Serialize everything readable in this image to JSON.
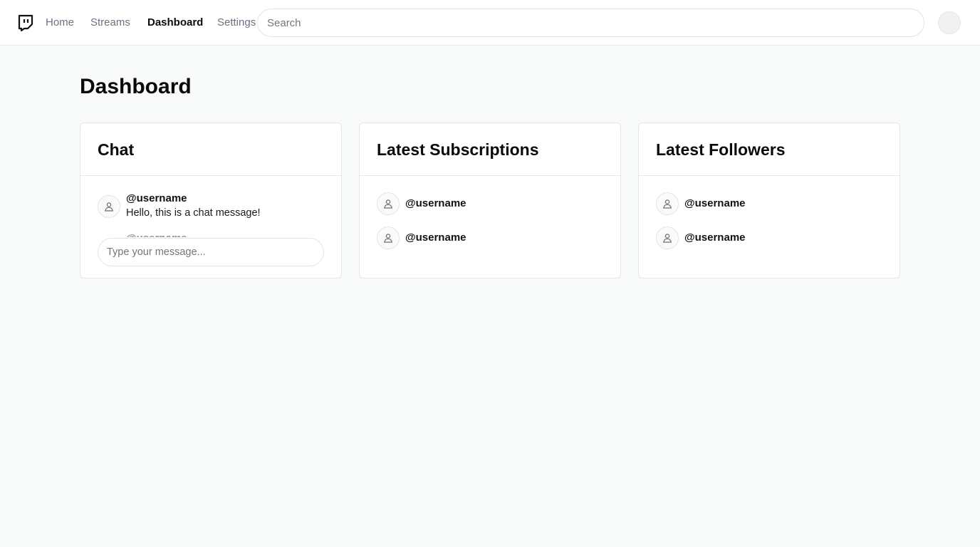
{
  "nav": {
    "logo_icon": "twitch-logo-icon",
    "links": [
      {
        "label": "Home",
        "active": false
      },
      {
        "label": "Streams",
        "active": false
      },
      {
        "label": "Dashboard",
        "active": true
      },
      {
        "label": "Settings",
        "active": false
      }
    ]
  },
  "search": {
    "placeholder": "Search",
    "value": ""
  },
  "user_menu": {
    "icon": "avatar-icon"
  },
  "page": {
    "title": "Dashboard"
  },
  "chat": {
    "title": "Chat",
    "messages": [
      {
        "username": "@username",
        "text": "Hello, this is a chat message!"
      },
      {
        "username": "@username",
        "text": ""
      }
    ],
    "input_placeholder": "Type your message...",
    "input_value": ""
  },
  "subscriptions": {
    "title": "Latest Subscriptions",
    "items": [
      {
        "username": "@username"
      },
      {
        "username": "@username"
      }
    ]
  },
  "followers": {
    "title": "Latest Followers",
    "items": [
      {
        "username": "@username"
      },
      {
        "username": "@username"
      }
    ]
  },
  "colors": {
    "background": "#f8f9f9",
    "surface": "#ffffff",
    "border": "#e4e6e8",
    "text": "#0a0a0a",
    "muted": "#6b7280"
  }
}
